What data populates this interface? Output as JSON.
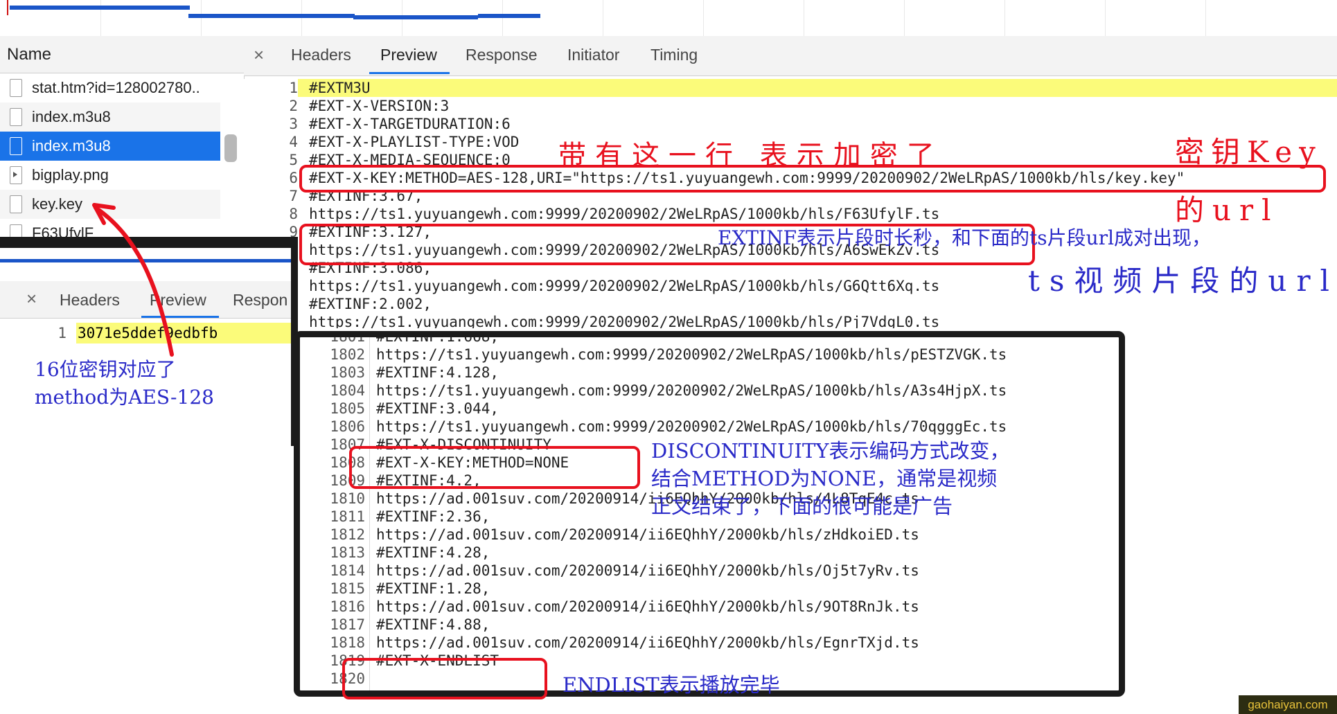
{
  "network": {
    "name_header": "Name",
    "rows": [
      {
        "label": "stat.htm?id=128002780.."
      },
      {
        "label": "index.m3u8"
      },
      {
        "label": "index.m3u8"
      },
      {
        "label": "bigplay.png"
      },
      {
        "label": "key.key"
      },
      {
        "label": "F63UfylF"
      }
    ]
  },
  "tabs": {
    "close": "×",
    "items": [
      "Headers",
      "Preview",
      "Response",
      "Initiator",
      "Timing"
    ],
    "active": "Preview"
  },
  "key_panel": {
    "tabs": [
      "Headers",
      "Preview",
      "Respon"
    ],
    "line_number": "1",
    "key_value": "3071e5ddef9edbfb"
  },
  "playlist_top": [
    {
      "n": "1",
      "text": "#EXTM3U"
    },
    {
      "n": "2",
      "text": "#EXT-X-VERSION:3"
    },
    {
      "n": "3",
      "text": "#EXT-X-TARGETDURATION:6"
    },
    {
      "n": "4",
      "text": "#EXT-X-PLAYLIST-TYPE:VOD"
    },
    {
      "n": "5",
      "text": "#EXT-X-MEDIA-SEQUENCE:0"
    },
    {
      "n": "6",
      "text": "#EXT-X-KEY:METHOD=AES-128,URI=\"https://ts1.yuyuangewh.com:9999/20200902/2WeLRpAS/1000kb/hls/key.key\""
    },
    {
      "n": "7",
      "text": "#EXTINF:3.67,"
    },
    {
      "n": "8",
      "text": "https://ts1.yuyuangewh.com:9999/20200902/2WeLRpAS/1000kb/hls/F63UfylF.ts"
    },
    {
      "n": "9",
      "text": "#EXTINF:3.127,"
    },
    {
      "n": "10",
      "text": "https://ts1.yuyuangewh.com:9999/20200902/2WeLRpAS/1000kb/hls/A6SwEkZv.ts"
    },
    {
      "n": "11",
      "text": "#EXTINF:3.086,"
    },
    {
      "n": "12",
      "text": "https://ts1.yuyuangewh.com:9999/20200902/2WeLRpAS/1000kb/hls/G6Qtt6Xq.ts"
    },
    {
      "n": "13",
      "text": "#EXTINF:2.002,"
    },
    {
      "n": "14",
      "text": "https://ts1.yuyuangewh.com:9999/20200902/2WeLRpAS/1000kb/hls/Pj7VdgL0.ts"
    }
  ],
  "playlist_bottom": [
    {
      "n": "1801",
      "text": "#EXTINF:1.668,"
    },
    {
      "n": "1802",
      "text": "https://ts1.yuyuangewh.com:9999/20200902/2WeLRpAS/1000kb/hls/pESTZVGK.ts"
    },
    {
      "n": "1803",
      "text": "#EXTINF:4.128,"
    },
    {
      "n": "1804",
      "text": "https://ts1.yuyuangewh.com:9999/20200902/2WeLRpAS/1000kb/hls/A3s4HjpX.ts"
    },
    {
      "n": "1805",
      "text": "#EXTINF:3.044,"
    },
    {
      "n": "1806",
      "text": "https://ts1.yuyuangewh.com:9999/20200902/2WeLRpAS/1000kb/hls/70qgggEc.ts"
    },
    {
      "n": "1807",
      "text": "#EXT-X-DISCONTINUITY"
    },
    {
      "n": "1808",
      "text": "#EXT-X-KEY:METHOD=NONE"
    },
    {
      "n": "1809",
      "text": "#EXTINF:4.2,"
    },
    {
      "n": "1810",
      "text": "https://ad.001suv.com/20200914/ii6EQhhY/2000kb/hls/4L8TqE4c.ts"
    },
    {
      "n": "1811",
      "text": "#EXTINF:2.36,"
    },
    {
      "n": "1812",
      "text": "https://ad.001suv.com/20200914/ii6EQhhY/2000kb/hls/zHdkoiED.ts"
    },
    {
      "n": "1813",
      "text": "#EXTINF:4.28,"
    },
    {
      "n": "1814",
      "text": "https://ad.001suv.com/20200914/ii6EQhhY/2000kb/hls/Oj5t7yRv.ts"
    },
    {
      "n": "1815",
      "text": "#EXTINF:1.28,"
    },
    {
      "n": "1816",
      "text": "https://ad.001suv.com/20200914/ii6EQhhY/2000kb/hls/9OT8RnJk.ts"
    },
    {
      "n": "1817",
      "text": "#EXTINF:4.88,"
    },
    {
      "n": "1818",
      "text": "https://ad.001suv.com/20200914/ii6EQhhY/2000kb/hls/EgnrTXjd.ts"
    },
    {
      "n": "1819",
      "text": "#EXT-X-ENDLIST"
    },
    {
      "n": "1820",
      "text": ""
    }
  ],
  "annotations": {
    "encrypted_line": "带有这一行 表示加密了",
    "key_url_1": "密钥Key",
    "key_url_2": "的url",
    "extinf_note": "EXTINF表示片段时长秒，和下面的ts片段url成对出现，",
    "ts_url": "ts视频片段的url",
    "key16_1": "16位密钥对应了",
    "key16_2": "method为AES-128",
    "disc_1": "DISCONTINUITY表示编码方式改变，",
    "disc_2": "结合METHOD为NONE，通常是视频",
    "disc_3": "正文结束了，下面的很可能是广告",
    "endlist": "ENDLIST表示播放完毕"
  },
  "watermark": "gaohaiyan.com",
  "colors": {
    "annotation_red": "#e8111e",
    "annotation_blue": "#2a2ac8",
    "selection_blue": "#1a73e8",
    "line_highlight": "#fbfb7a"
  }
}
